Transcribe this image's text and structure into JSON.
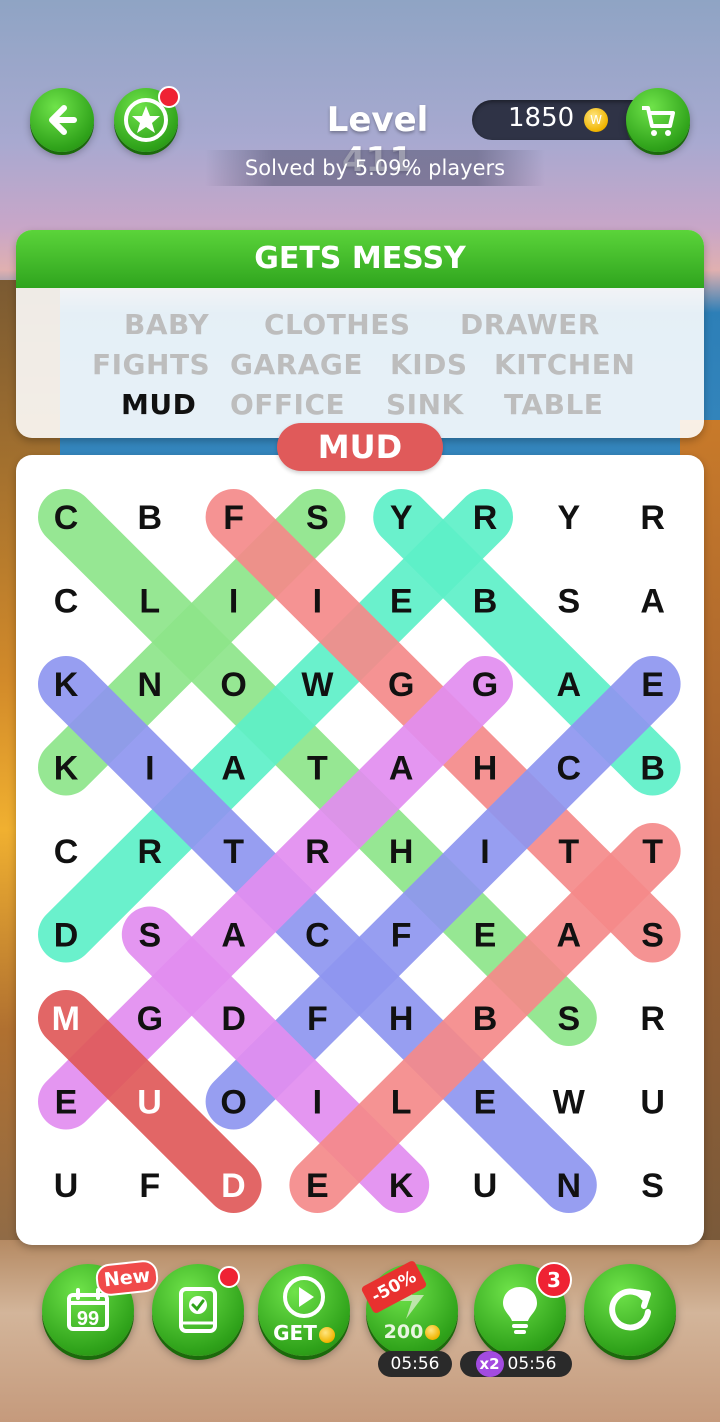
{
  "header": {
    "level": "Level 411",
    "solved_by": "Solved by 5.09% players",
    "coins": "1850",
    "coin_letter": "W"
  },
  "theme": {
    "title": "GETS MESSY"
  },
  "words": [
    {
      "text": "BABY",
      "found": false
    },
    {
      "text": "CLOTHES",
      "found": false
    },
    {
      "text": "DRAWER",
      "found": false
    },
    {
      "text": "FIGHTS",
      "found": false
    },
    {
      "text": "GARAGE",
      "found": false
    },
    {
      "text": "KIDS",
      "found": false
    },
    {
      "text": "KITCHEN",
      "found": false
    },
    {
      "text": "MUD",
      "found": true
    },
    {
      "text": "OFFICE",
      "found": false
    },
    {
      "text": "SINK",
      "found": false
    },
    {
      "text": "TABLE",
      "found": false
    }
  ],
  "current_word": "MUD",
  "grid": [
    [
      "C",
      "B",
      "F",
      "S",
      "Y",
      "R",
      "Y",
      "R"
    ],
    [
      "C",
      "L",
      "I",
      "I",
      "E",
      "B",
      "S",
      "A"
    ],
    [
      "K",
      "N",
      "O",
      "W",
      "G",
      "G",
      "A",
      "E"
    ],
    [
      "K",
      "I",
      "A",
      "T",
      "A",
      "H",
      "C",
      "B"
    ],
    [
      "C",
      "R",
      "T",
      "R",
      "H",
      "I",
      "T",
      "T"
    ],
    [
      "D",
      "S",
      "A",
      "C",
      "F",
      "E",
      "A",
      "S"
    ],
    [
      "M",
      "G",
      "D",
      "F",
      "H",
      "B",
      "S",
      "R"
    ],
    [
      "E",
      "U",
      "O",
      "I",
      "L",
      "E",
      "W",
      "U"
    ],
    [
      "U",
      "F",
      "D",
      "E",
      "K",
      "U",
      "N",
      "S"
    ]
  ],
  "highlights": [
    {
      "color": "#8ee58a",
      "from": [
        0,
        0
      ],
      "to": [
        6,
        6
      ]
    },
    {
      "color": "#8ee58a",
      "from": [
        0,
        3
      ],
      "to": [
        3,
        0
      ]
    },
    {
      "color": "#5ef0c8",
      "from": [
        0,
        4
      ],
      "to": [
        3,
        7
      ]
    },
    {
      "color": "#5ef0c8",
      "from": [
        0,
        5
      ],
      "to": [
        5,
        0
      ]
    },
    {
      "color": "#f58a8a",
      "from": [
        0,
        2
      ],
      "to": [
        5,
        7
      ]
    },
    {
      "color": "#8f96f0",
      "from": [
        2,
        0
      ],
      "to": [
        8,
        6
      ]
    },
    {
      "color": "#8f96f0",
      "from": [
        2,
        7
      ],
      "to": [
        7,
        2
      ]
    },
    {
      "color": "#e28ef0",
      "from": [
        2,
        5
      ],
      "to": [
        7,
        0
      ]
    },
    {
      "color": "#e28ef0",
      "from": [
        5,
        1
      ],
      "to": [
        8,
        4
      ]
    },
    {
      "color": "#f58a8a",
      "from": [
        4,
        7
      ],
      "to": [
        8,
        3
      ]
    },
    {
      "color": "#e05a5a",
      "from": [
        6,
        0
      ],
      "to": [
        8,
        2
      ]
    }
  ],
  "toolbar": {
    "new_badge": "New",
    "get_label": "GET",
    "discount": "-50%",
    "energy_cost": "200",
    "hint_count": "3",
    "timer1": "05:56",
    "timer2": "05:56",
    "multiplier": "x2"
  }
}
